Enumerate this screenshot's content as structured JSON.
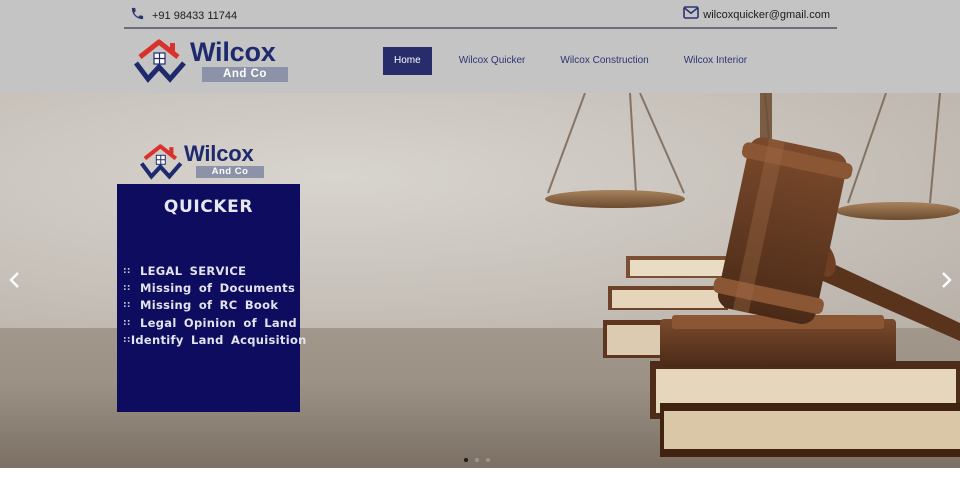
{
  "topbar": {
    "phone_icon": "phone-icon",
    "phone": "+91 98433 11744",
    "email_icon": "mail-icon",
    "email": "wilcoxquicker@gmail.com"
  },
  "logo": {
    "name": "Wilcox",
    "sub": "And Co"
  },
  "nav": {
    "items": [
      {
        "label": "Home",
        "active": true
      },
      {
        "label": "Wilcox Quicker",
        "active": false
      },
      {
        "label": "Wilcox Construction",
        "active": false
      },
      {
        "label": "Wilcox Interior",
        "active": false
      }
    ]
  },
  "slider": {
    "prev_icon": "chevron-left-icon",
    "next_icon": "chevron-right-icon",
    "slide": {
      "logo_name": "Wilcox",
      "logo_sub": "And Co",
      "title": "QUICKER",
      "bullet": "::",
      "services": [
        "LEGAL SERVICE",
        "Missing of Documents",
        "Missing of RC Book",
        "Legal Opinion of Land",
        "Identify Land Acquisition"
      ]
    },
    "dots": [
      {
        "active": true
      },
      {
        "active": false
      },
      {
        "active": false
      }
    ]
  },
  "colors": {
    "header_bg": "#c4c4c4",
    "brand_navy": "#1f2a6e",
    "nav_active_bg": "#292c6b",
    "card_bg": "#0d0c5e",
    "logo_roof": "#d9312b"
  }
}
